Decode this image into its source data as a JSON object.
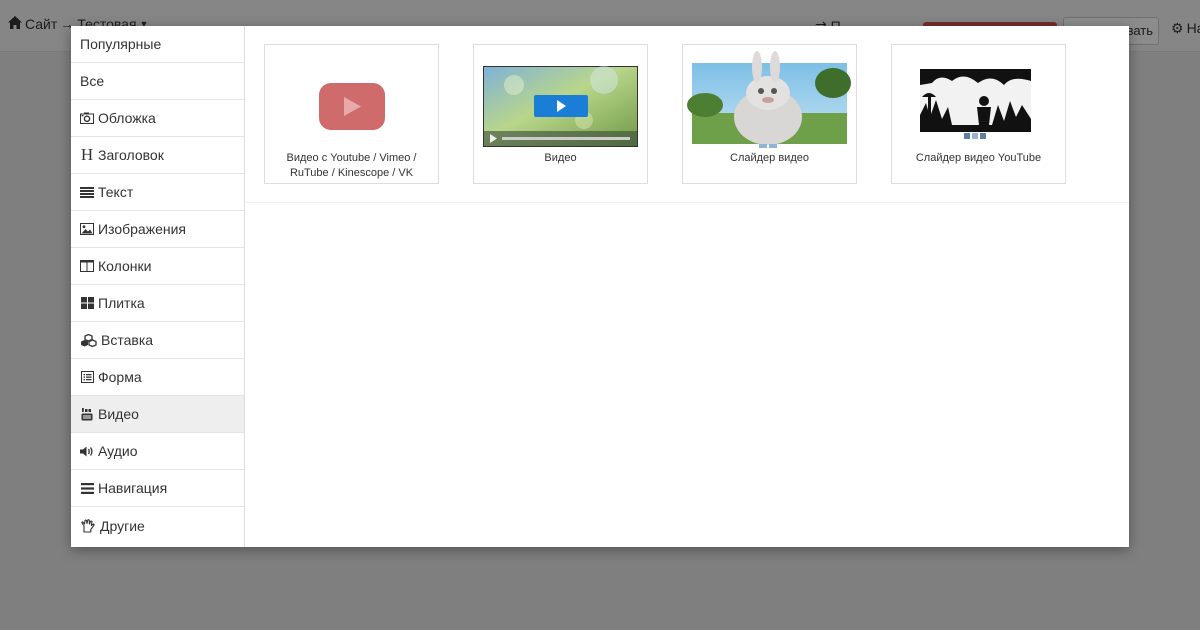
{
  "topbar": {
    "breadcrumb_site": "Сайт",
    "breadcrumb_arrow": "→",
    "breadcrumb_page": "Тестовая",
    "middle_text": "⇄ П",
    "white_button_label": "вать",
    "settings_label": "На"
  },
  "categories": [
    {
      "label": "Популярные",
      "icon": "none"
    },
    {
      "label": "Все",
      "icon": "none"
    },
    {
      "label": "Обложка",
      "icon": "camera-icon"
    },
    {
      "label": "Заголовок",
      "icon": "header-icon"
    },
    {
      "label": "Текст",
      "icon": "align-justify-icon"
    },
    {
      "label": "Изображения",
      "icon": "picture-icon"
    },
    {
      "label": "Колонки",
      "icon": "columns-icon"
    },
    {
      "label": "Плитка",
      "icon": "th-large-icon"
    },
    {
      "label": "Вставка",
      "icon": "cubes-icon"
    },
    {
      "label": "Форма",
      "icon": "list-alt-icon"
    },
    {
      "label": "Видео",
      "icon": "youtube-icon",
      "active": true
    },
    {
      "label": "Аудио",
      "icon": "volume-icon"
    },
    {
      "label": "Навигация",
      "icon": "bars-icon"
    },
    {
      "label": "Другие",
      "icon": "hand-icon"
    }
  ],
  "blocks": [
    {
      "label": "Видео с Youtube / Vimeo / RuTube / Kinescope / VK",
      "thumb": "youtube-logo"
    },
    {
      "label": "Видео",
      "thumb": "video-player"
    },
    {
      "label": "Слайдер видео",
      "thumb": "bunny-video"
    },
    {
      "label": "Слайдер видео YouTube",
      "thumb": "dark-forest-video"
    }
  ],
  "colors": {
    "youtube_red": "#cf6b6b",
    "play_blue": "#1a7dd6",
    "active_category_bg": "#eeeeee",
    "top_red_button": "#d9534f"
  }
}
